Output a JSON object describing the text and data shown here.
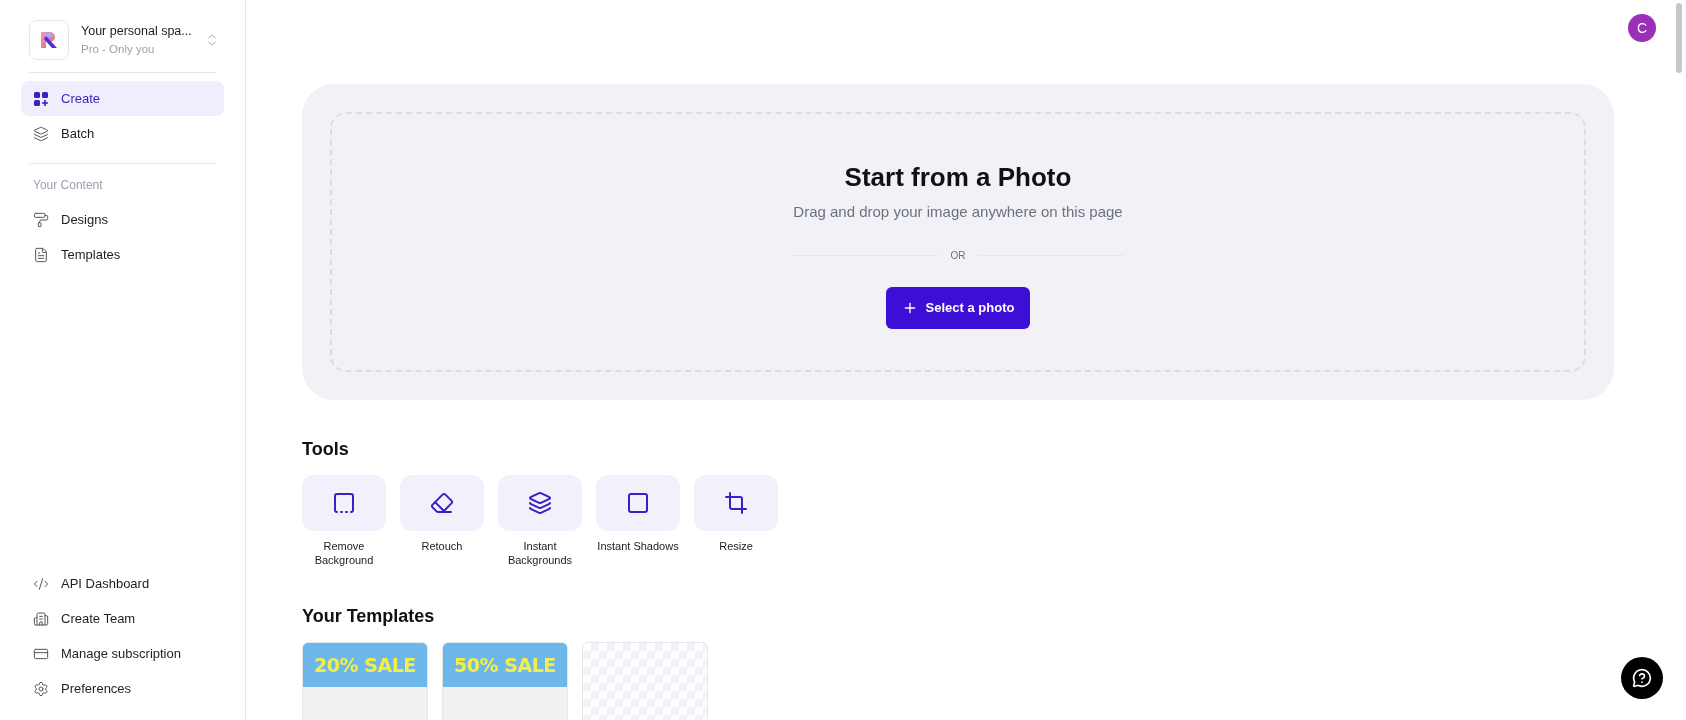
{
  "workspace": {
    "name": "Your personal spa...",
    "plan": "Pro - Only you"
  },
  "nav": [
    {
      "label": "Create",
      "selected": true
    },
    {
      "label": "Batch",
      "selected": false
    }
  ],
  "content_section": {
    "title": "Your Content",
    "items": [
      {
        "label": "Designs",
        "selected": false
      },
      {
        "label": "Templates",
        "selected": false
      }
    ]
  },
  "bottom_nav": [
    {
      "label": "API Dashboard"
    },
    {
      "label": "Create Team"
    },
    {
      "label": "Manage subscription"
    },
    {
      "label": "Preferences"
    }
  ],
  "avatar": {
    "initial": "C"
  },
  "dropzone": {
    "title": "Start from a Photo",
    "subtitle": "Drag and drop your image anywhere on this page",
    "divider": "OR",
    "button": "Select a photo"
  },
  "tools": {
    "title": "Tools",
    "items": [
      {
        "label": "Remove Background"
      },
      {
        "label": "Retouch"
      },
      {
        "label": "Instant Backgrounds"
      },
      {
        "label": "Instant Shadows"
      },
      {
        "label": "Resize"
      }
    ]
  },
  "templates": {
    "title": "Your Templates",
    "items": [
      {
        "kind": "sale",
        "text": "20% SALE"
      },
      {
        "kind": "sale",
        "text": "50% SALE"
      },
      {
        "kind": "blank"
      }
    ]
  }
}
